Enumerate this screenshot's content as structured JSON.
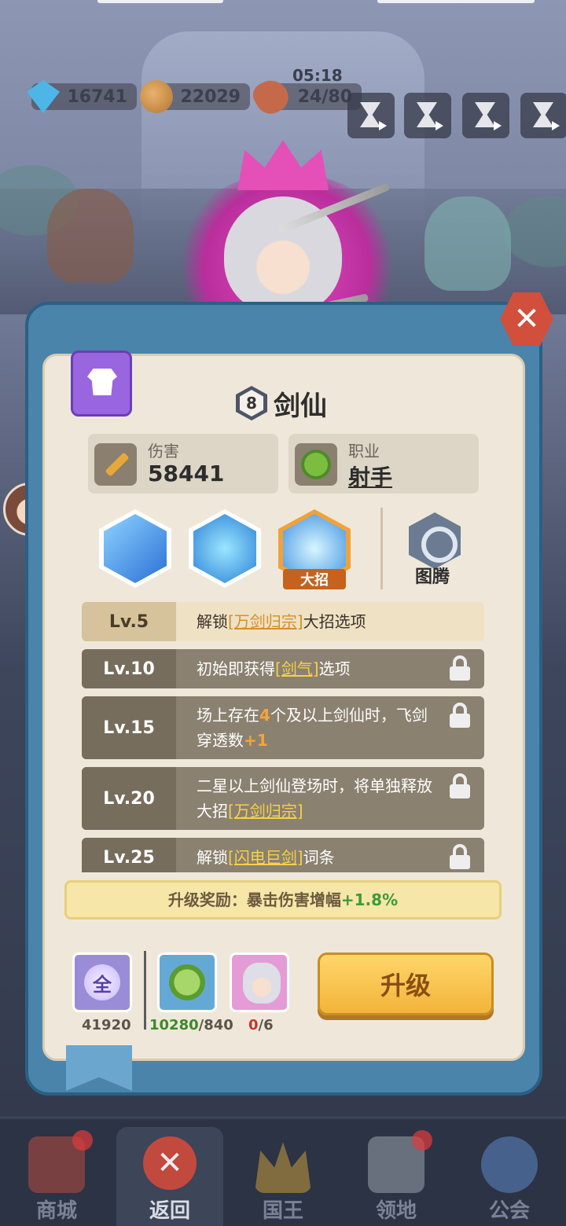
{
  "resources": {
    "gems": "16741",
    "coins": "22029",
    "stamina": "24/80",
    "stamina_timer": "05:18"
  },
  "hero": {
    "level": "8",
    "name": "剑仙"
  },
  "stats": {
    "damage_label": "伤害",
    "damage_value": "58441",
    "job_label": "职业",
    "job_value": "射手"
  },
  "skills": {
    "ultimate_tag": "大招",
    "totem_label": "图腾"
  },
  "level_unlocks": [
    {
      "level": "Lv.5",
      "pre": "解锁",
      "hl": "[万剑归宗]",
      "post": "大招选项",
      "locked": false
    },
    {
      "level": "Lv.10",
      "pre": "初始即获得",
      "hl": "[剑气]",
      "post": "选项",
      "locked": true
    },
    {
      "level": "Lv.15",
      "pre": "场上存在",
      "num": "4",
      "mid": "个及以上剑仙时，飞剑穿透数",
      "num2": "+1",
      "locked": true
    },
    {
      "level": "Lv.20",
      "pre": "二星以上剑仙登场时，将单独释放大招",
      "hl": "[万剑归宗]",
      "locked": true
    },
    {
      "level": "Lv.25",
      "pre": "解锁",
      "hl": "[闪电巨剑]",
      "post": "词条",
      "locked": true
    }
  ],
  "reward": {
    "label": "升级奖励：暴击伤害增幅",
    "value": "+1.8%"
  },
  "costs": {
    "all_badge": "全",
    "all_count": "41920",
    "job_have": "10280",
    "job_need": "/840",
    "hero_have": "0",
    "hero_need": "/6"
  },
  "upgrade_label": "升级",
  "nav": {
    "shop": "商城",
    "back": "返回",
    "king": "国王",
    "territory": "领地",
    "guild": "公会"
  }
}
